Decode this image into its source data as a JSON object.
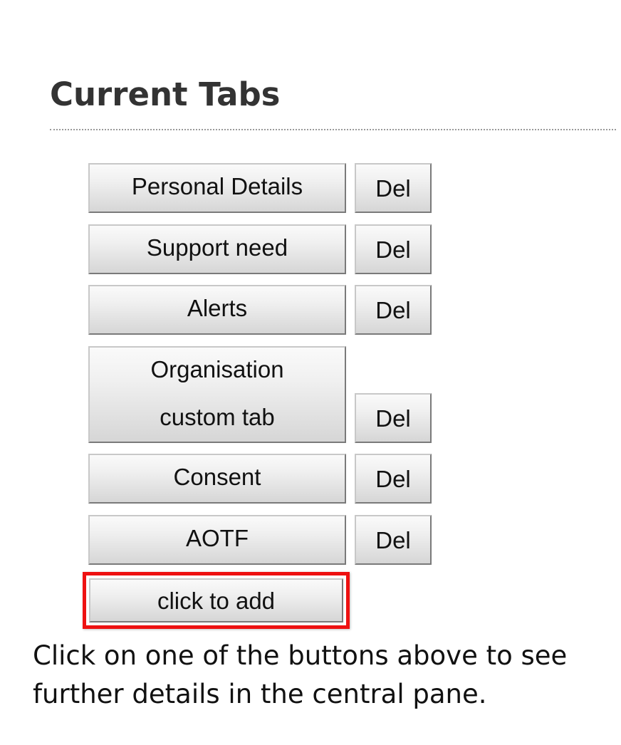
{
  "header": {
    "title": "Current Tabs"
  },
  "tabs": [
    {
      "label": "Personal Details",
      "delete_label": "Del"
    },
    {
      "label": "Support need",
      "delete_label": "Del"
    },
    {
      "label": "Alerts",
      "delete_label": "Del"
    },
    {
      "label": "Organisation custom tab",
      "delete_label": "Del"
    },
    {
      "label": "Consent",
      "delete_label": "Del"
    },
    {
      "label": "AOTF",
      "delete_label": "Del"
    }
  ],
  "add_button": {
    "label": "click to add",
    "highlight_color": "#ee1111"
  },
  "instructions": "Click on one of the buttons above to see further details in the central pane."
}
